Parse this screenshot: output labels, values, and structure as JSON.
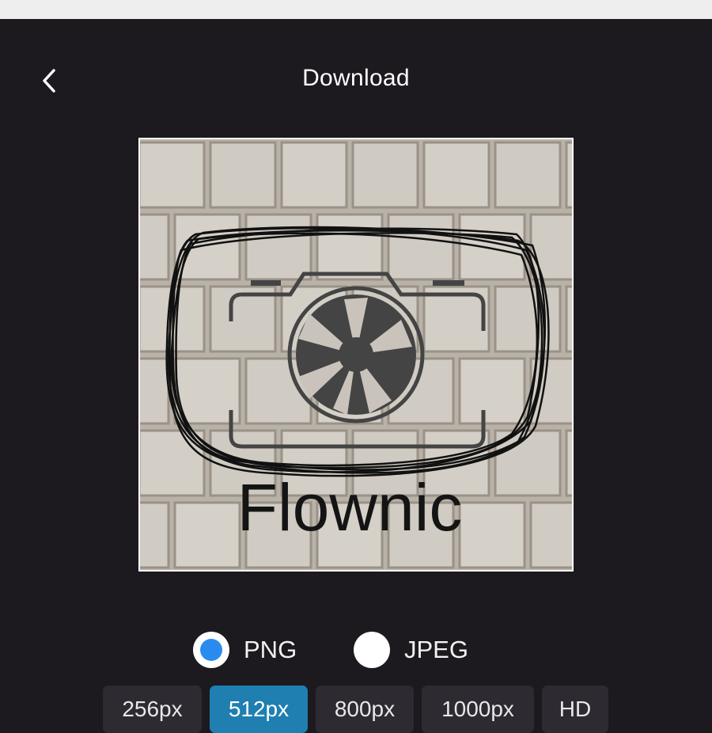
{
  "header": {
    "title": "Download",
    "back_icon": "chevron-left-icon"
  },
  "preview": {
    "logo_text": "Flownic",
    "logo_icon": "camera-shutter-icon",
    "background": "stone-brick-wall"
  },
  "formats": [
    {
      "label": "PNG",
      "selected": true
    },
    {
      "label": "JPEG",
      "selected": false
    }
  ],
  "sizes": [
    {
      "label": "256px",
      "selected": false
    },
    {
      "label": "512px",
      "selected": true
    },
    {
      "label": "800px",
      "selected": false
    },
    {
      "label": "1000px",
      "selected": false
    },
    {
      "label": "HD",
      "selected": false
    }
  ],
  "colors": {
    "background": "#1c191f",
    "accent": "#2a8bef",
    "selected_size": "#1e7fb0",
    "size_button": "#2d2a31"
  }
}
